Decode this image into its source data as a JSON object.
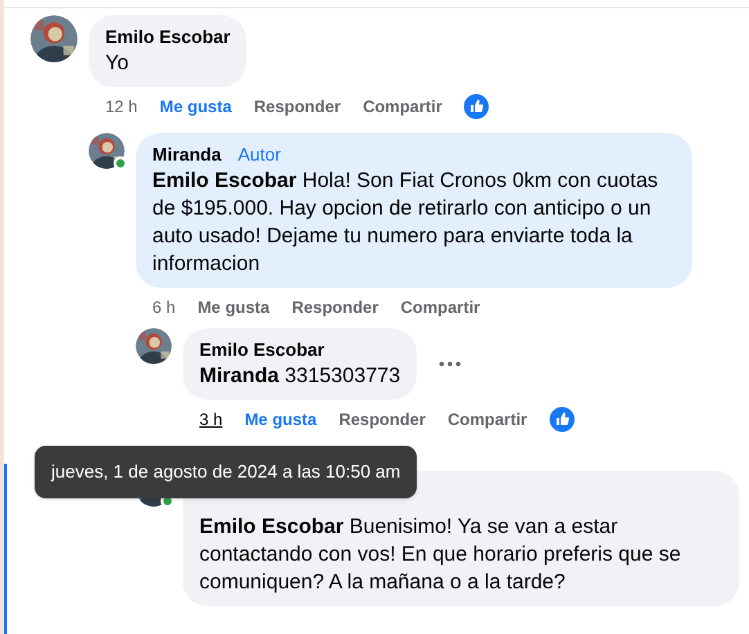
{
  "comments": [
    {
      "author": "Emilo Escobar",
      "text": "Yo",
      "online": false,
      "highlighted": false,
      "time": "12 h",
      "time_hovered": false,
      "like_label": "Me gusta",
      "liked": true,
      "reply_label": "Responder",
      "share_label": "Compartir",
      "has_reaction": true,
      "more": false,
      "children": [
        {
          "author": "Miranda",
          "badge": "Autor",
          "text": "**Emilo Escobar** Hola! Son Fiat Cronos 0km con cuotas de $195.000. Hay opcion de retirarlo con anticipo o un auto usado! Dejame tu numero para enviarte toda la informacion",
          "online": true,
          "highlighted": true,
          "time": "6 h",
          "time_hovered": false,
          "like_label": "Me gusta",
          "liked": false,
          "reply_label": "Responder",
          "share_label": "Compartir",
          "has_reaction": false,
          "more": false,
          "children": [
            {
              "author": "Emilo Escobar",
              "text": "**Miranda** 3315303773",
              "online": false,
              "highlighted": false,
              "time": "3 h",
              "time_hovered": true,
              "like_label": "Me gusta",
              "liked": true,
              "reply_label": "Responder",
              "share_label": "Compartir",
              "has_reaction": true,
              "more": true
            },
            {
              "name_covered": true,
              "text": "**Emilo Escobar** Buenisimo! Ya se van a estar contactando con vos! En que horario preferis que se comuniquen? A la mañana o a la tarde?",
              "online": true,
              "highlighted": false
            }
          ]
        }
      ]
    }
  ],
  "tooltip": {
    "text": "jueves, 1 de agosto de 2024 a las 10:50 am"
  }
}
